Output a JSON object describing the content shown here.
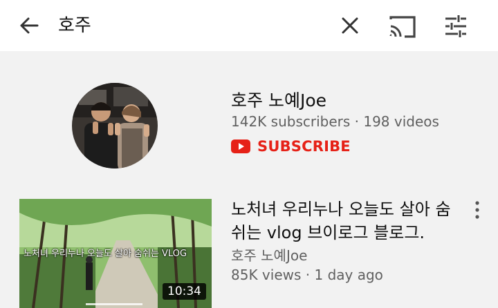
{
  "search": {
    "query": "호주",
    "icons": {
      "back": "arrow-back-icon",
      "clear": "close-icon",
      "cast": "cast-icon",
      "filter": "filter-sliders-icon"
    }
  },
  "channel": {
    "name": "호주 노예Joe",
    "subscribers": "142K subscribers",
    "separator": " · ",
    "videos": "198 videos",
    "subscribe_label": "SUBSCRIBE",
    "subscribe_color": "#e62117"
  },
  "video": {
    "title": "노처녀 우리누나 오늘도 살아 숨쉬는 vlog 브이로그 블로그.",
    "thumbnail_caption": "노처녀 우리누나 오늘도 살아 숨쉬는 VLOG",
    "duration": "10:34",
    "channel": "호주 노예Joe",
    "views": "85K views",
    "age": "1 day ago",
    "separator": " · "
  },
  "colors": {
    "topbar_bg": "#ffffff",
    "page_bg": "#f2f2f2",
    "secondary_text": "#606060"
  }
}
